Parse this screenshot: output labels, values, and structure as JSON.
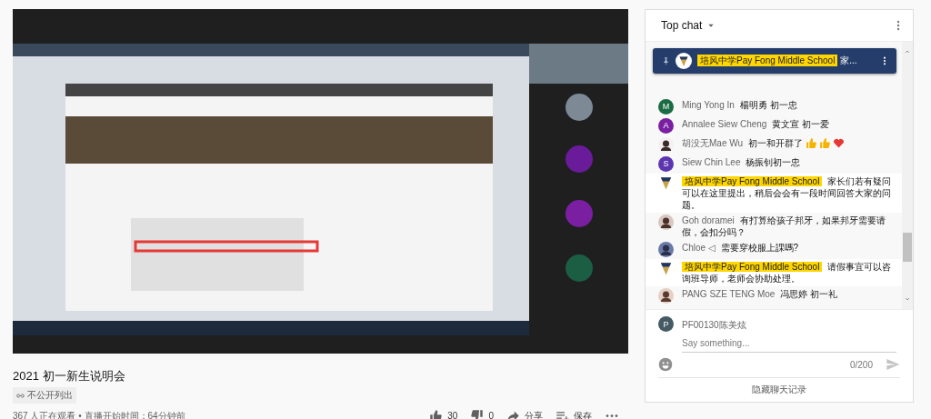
{
  "title": "2021 初一新生说明会",
  "visibility": "不公开列出",
  "stats": "367 人正在观看 • 直播开始时间：64分钟前",
  "actions": [
    {
      "kind": "like",
      "label": "30"
    },
    {
      "kind": "dislike",
      "label": "0"
    },
    {
      "kind": "share",
      "label": "分享"
    },
    {
      "kind": "save",
      "label": "保存"
    },
    {
      "kind": "more"
    }
  ],
  "chat": {
    "header": "Top chat",
    "pinned": {
      "author": "培风中学Pay Fong Middle School",
      "text": "家..."
    },
    "messages": [
      {
        "kind": "letter",
        "letter": "M",
        "color": "#1b6b44",
        "author": "Ming Yong In",
        "text": "楊明勇 初一忠"
      },
      {
        "kind": "letter",
        "letter": "A",
        "color": "#7b1fa2",
        "author": "Annalee Siew Cheng",
        "text": "黄文宣 初一爱"
      },
      {
        "author": "胡没无Mae Wu",
        "text": "初一和开群了",
        "emojis": [
          {
            "kind": "thumbs-up"
          },
          {
            "kind": "thumbs-up"
          },
          {
            "kind": "heart"
          }
        ]
      },
      {
        "kind": "letter",
        "letter": "S",
        "color": "#5e35b1",
        "author": "Siew Chin Lee",
        "text": "杨振钊初一忠"
      },
      {
        "kind": "owner",
        "author": "培风中学Pay Fong Middle School",
        "text": "家长们若有疑问可以在这里提出，稍后会会有一段时间回答大家的问题。"
      },
      {
        "author": "Goh doramei",
        "text": "有打算给孩子邦牙，如果邦牙需要请假，会扣分吗？"
      },
      {
        "author": "Chloe ◁",
        "text": "需要穿校服上課嗎?"
      },
      {
        "kind": "owner",
        "author": "培风中学Pay Fong Middle School",
        "text": "请假事宜可以咨询班导师，老师会协助处理。"
      },
      {
        "author": "PANG SZE TENG Moe",
        "text": "冯思婷 初一礼"
      }
    ],
    "input": {
      "letter": "P",
      "user": "PF00130陈美炫",
      "placeholder": "Say something...",
      "counter": "0/200"
    },
    "hide_button": "隐藏聊天记录"
  }
}
